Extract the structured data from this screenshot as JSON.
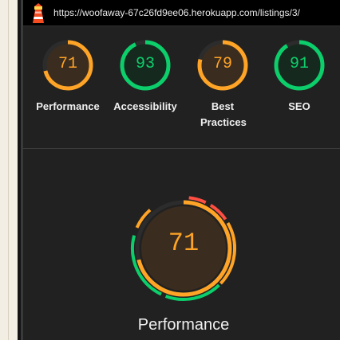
{
  "browser": {
    "url": "https://woofaway-67c26fd9ee06.herokuapp.com/listings/3/"
  },
  "colors": {
    "average": "#ffa426",
    "pass": "#0cce6b",
    "fail": "#ff4e42",
    "average_fill": "#3a2c1f",
    "pass_fill": "#16291e",
    "track": "#2c2c2c"
  },
  "categories": [
    {
      "label": "Performance",
      "score": "71",
      "rating": "average"
    },
    {
      "label": "Accessibility",
      "score": "93",
      "rating": "pass"
    },
    {
      "label": "Best Practices",
      "score": "79",
      "rating": "average"
    },
    {
      "label": "SEO",
      "score": "91",
      "rating": "pass"
    }
  ],
  "performance_detail": {
    "score": "71",
    "title": "Performance"
  }
}
